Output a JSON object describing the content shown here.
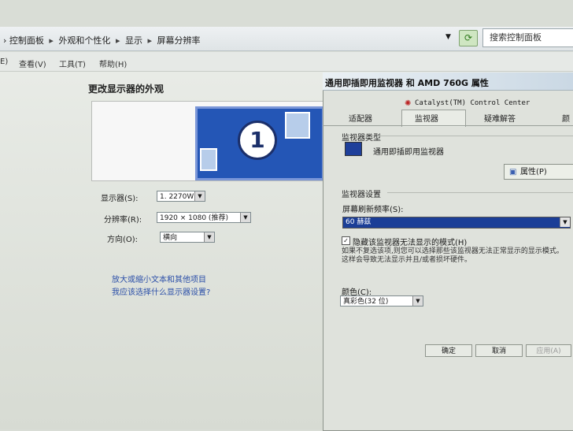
{
  "breadcrumb": [
    "控制面板",
    "外观和个性化",
    "显示",
    "屏幕分辨率"
  ],
  "search": {
    "placeholder": "搜索控制面板"
  },
  "menu": [
    "E)",
    "查看(V)",
    "工具(T)",
    "帮助(H)"
  ],
  "main": {
    "heading": "更改显示器的外观",
    "monitor_number": "1",
    "display_label": "显示器(S):",
    "display_value": "1. 2270W",
    "resolution_label": "分辨率(R):",
    "resolution_value": "1920 × 1080 (推荐)",
    "orientation_label": "方向(O):",
    "orientation_value": "横向",
    "link_text_size": "放大或缩小文本和其他项目",
    "link_which_settings": "我应该选择什么显示器设置?"
  },
  "dialog": {
    "title": "通用即插即用监视器 和 AMD 760G 属性",
    "catalyst": "Catalyst(TM) Control Center",
    "tabs": [
      "适配器",
      "监视器",
      "疑难解答",
      "颜"
    ],
    "monitor_type_group": "监视器类型",
    "monitor_type_value": "通用即插即用监视器",
    "properties_button": "属性(P)",
    "monitor_settings_group": "监视器设置",
    "refresh_label": "屏幕刷新频率(S):",
    "refresh_value": "60 赫兹",
    "hide_modes_label": "隐藏该监视器无法显示的模式(H)",
    "hide_modes_checked": true,
    "description": "如果不复选该项,则您可以选择那些该监视器无法正常显示的显示模式。这样会导致无法显示并且/或者损坏硬件。",
    "colors_label": "颜色(C):",
    "colors_value": "真彩色(32 位)",
    "ok_button": "确定",
    "cancel_button": "取消",
    "apply_button": "应用(A)"
  }
}
